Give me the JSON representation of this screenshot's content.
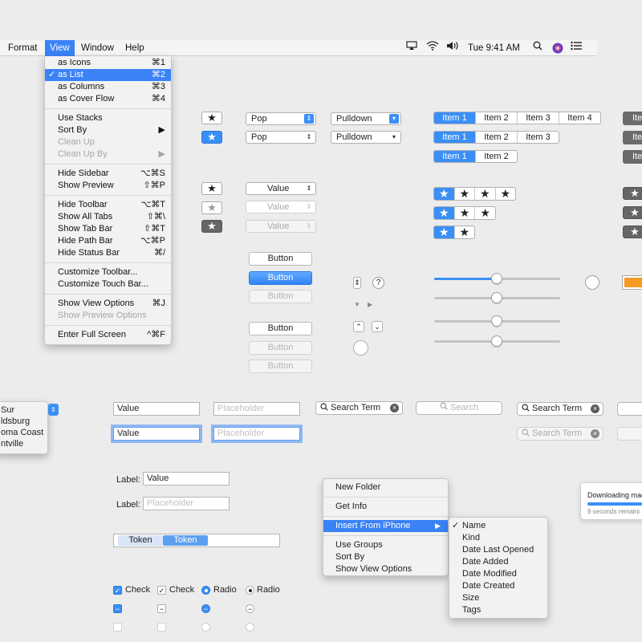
{
  "menubar": {
    "format": "Format",
    "view": "View",
    "window": "Window",
    "help": "Help",
    "clock": "Tue 9:41 AM"
  },
  "view_menu": {
    "items": [
      {
        "label": "as Icons",
        "shortcut": "⌘1"
      },
      {
        "label": "as List",
        "shortcut": "⌘2",
        "check": "✓"
      },
      {
        "label": "as Columns",
        "shortcut": "⌘3"
      },
      {
        "label": "as Cover Flow",
        "shortcut": "⌘4"
      },
      {
        "label": "Use Stacks",
        "shortcut": ""
      },
      {
        "label": "Sort By",
        "shortcut": "▶"
      },
      {
        "label": "Clean Up",
        "shortcut": ""
      },
      {
        "label": "Clean Up By",
        "shortcut": "▶"
      },
      {
        "label": "Hide Sidebar",
        "shortcut": "⌥⌘S"
      },
      {
        "label": "Show Preview",
        "shortcut": "⇧⌘P"
      },
      {
        "label": "Hide Toolbar",
        "shortcut": "⌥⌘T"
      },
      {
        "label": "Show All Tabs",
        "shortcut": "⇧⌘\\"
      },
      {
        "label": "Show Tab Bar",
        "shortcut": "⇧⌘T"
      },
      {
        "label": "Hide Path Bar",
        "shortcut": "⌥⌘P"
      },
      {
        "label": "Hide Status Bar",
        "shortcut": "⌘/"
      },
      {
        "label": "Customize Toolbar...",
        "shortcut": ""
      },
      {
        "label": "Customize Touch Bar...",
        "shortcut": ""
      },
      {
        "label": "Show View Options",
        "shortcut": "⌘J"
      },
      {
        "label": "Show Preview Options",
        "shortcut": ""
      },
      {
        "label": "Enter Full Screen",
        "shortcut": "^⌘F"
      }
    ]
  },
  "popups": {
    "pop": "Pop",
    "pulldown": "Pulldown",
    "value": "Value"
  },
  "segments": {
    "item1": "Item 1",
    "item2": "Item 2",
    "item3": "Item 3",
    "item4": "Item 4",
    "ite": "Ite"
  },
  "buttons": {
    "button": "Button"
  },
  "fields": {
    "value": "Value",
    "placeholder": "Placeholder",
    "search_term": "Search Term",
    "search": "Search",
    "label": "Label:"
  },
  "combo_list": [
    "Sur",
    "ldsburg",
    "oma Coast",
    "ntville"
  ],
  "tokens": {
    "token1": "Token",
    "token2": "Token"
  },
  "context_menu": {
    "items": [
      "New Folder",
      "Get Info",
      "Insert From iPhone",
      "Use Groups",
      "Sort By",
      "Show View Options"
    ],
    "submenu_arrow": "▶"
  },
  "sort_submenu": {
    "check": "✓",
    "items": [
      "Name",
      "Kind",
      "Date Last Opened",
      "Date Added",
      "Date Modified",
      "Date Created",
      "Size",
      "Tags"
    ]
  },
  "checks": {
    "check": "Check",
    "radio": "Radio"
  },
  "download": {
    "title": "Downloading mac",
    "remaining": "9 seconds remaini",
    "progress": 0.85
  },
  "icons": [
    "airplay-icon",
    "wifi-icon",
    "volume-icon",
    "search-icon",
    "siri-icon",
    "list-icon",
    "star-icon",
    "help-icon",
    "stepper-icon",
    "disclosure-icon"
  ],
  "colors": {
    "accent": "#3a8ff7",
    "orange": "#f59a23"
  }
}
